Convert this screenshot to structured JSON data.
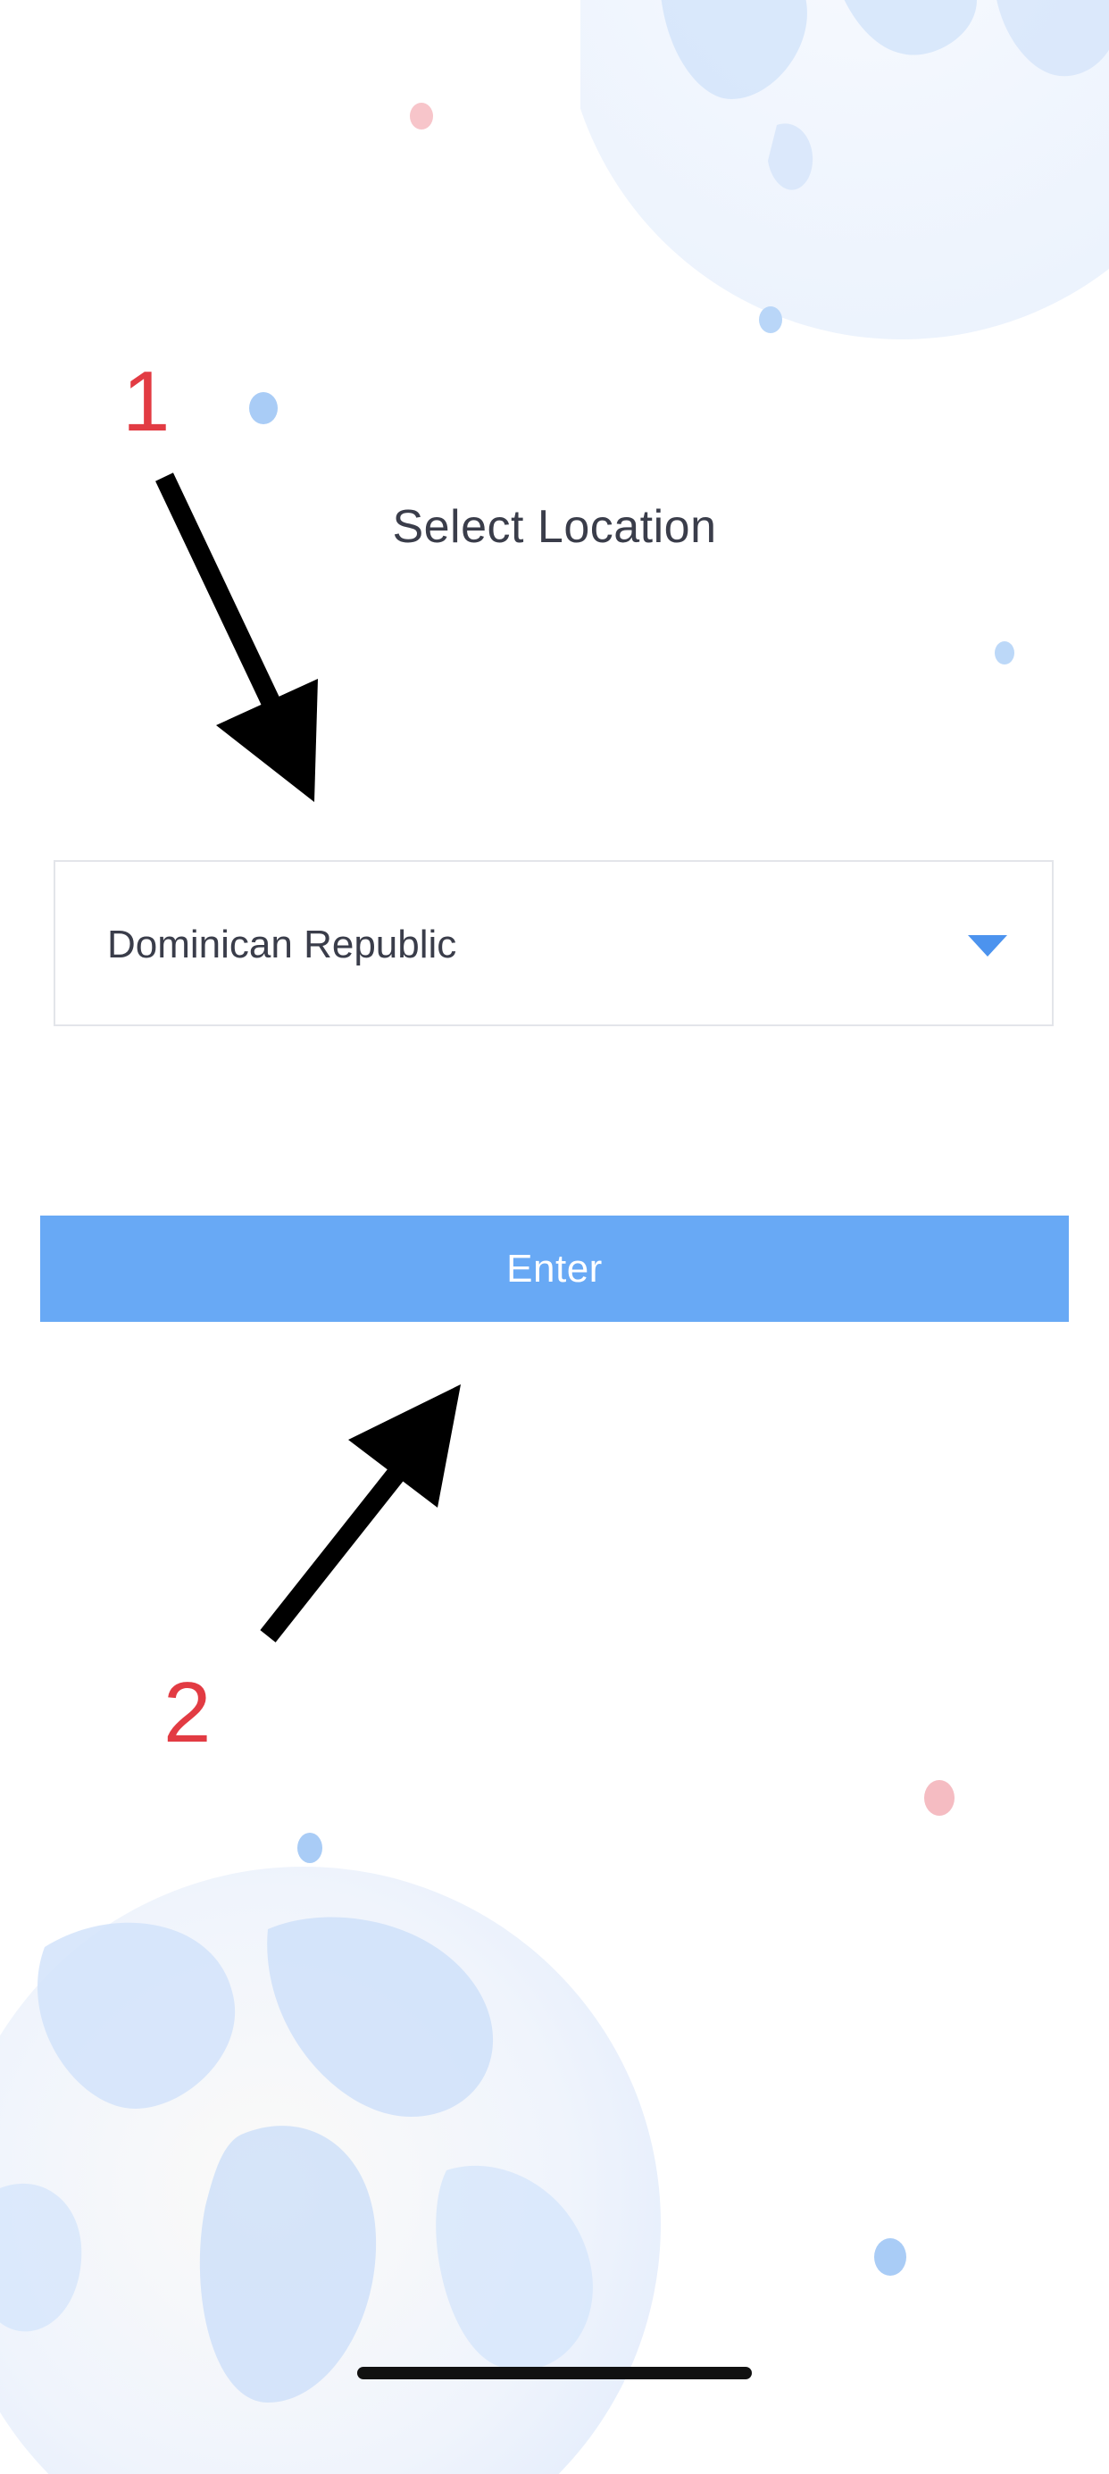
{
  "page": {
    "title": "Select Location"
  },
  "location_select": {
    "value": "Dominican Republic",
    "icon": "caret-down-icon"
  },
  "enter_button": {
    "label": "Enter"
  },
  "annotations": {
    "step_1": "1",
    "step_2": "2"
  },
  "colors": {
    "accent": "#68a9f5",
    "caret": "#4c93ee",
    "annotation_red": "#e23b43",
    "text": "#3a3d4a",
    "globe": "#d6e6fb",
    "dot_blue": "#9ec7f5",
    "dot_pink": "#f5b7bd"
  }
}
